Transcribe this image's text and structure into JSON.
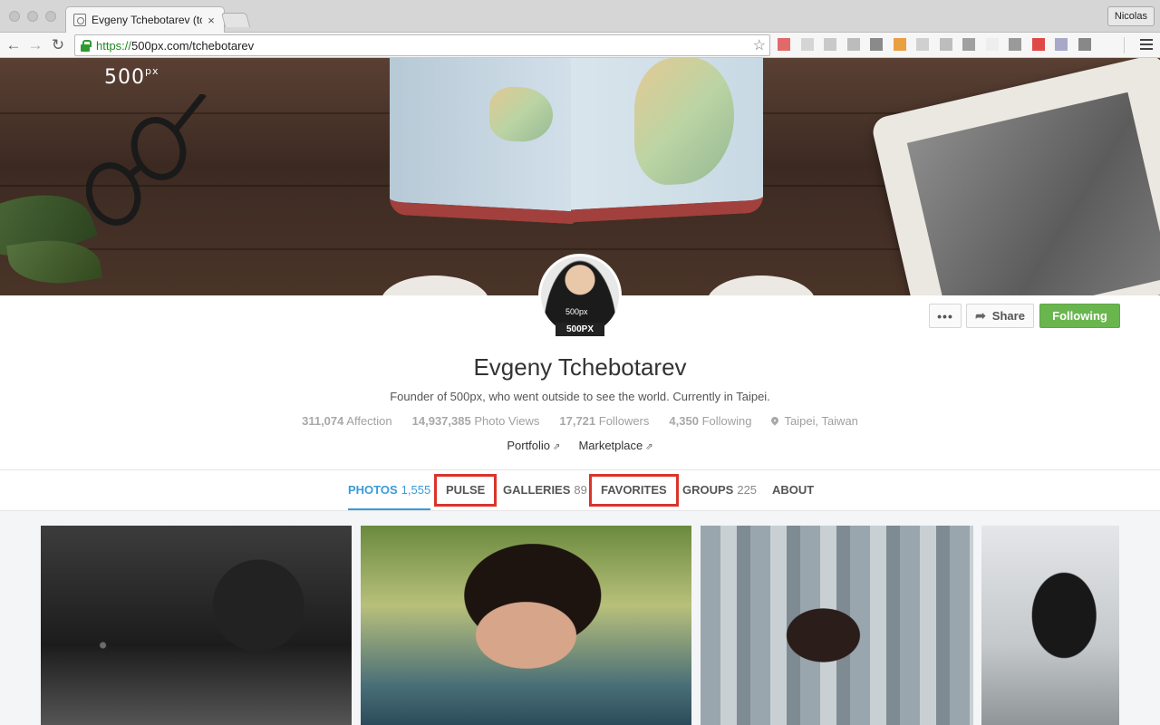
{
  "browser": {
    "tab_title": "Evgeny Tchebotarev (tcheb",
    "tab_close": "×",
    "user_name": "Nicolas",
    "url_scheme": "https://",
    "url_rest": "500px.com/tchebotarev",
    "back_icon": "←",
    "forward_icon": "→",
    "reload_icon": "↻",
    "star_icon": "☆",
    "extension_colors": [
      "#e06a6a",
      "#d5d5d5",
      "#c9c9c9",
      "#bcbcbc",
      "#8a8a8a",
      "#e8a040",
      "#d0d0d0",
      "#bdbdbd",
      "#a0a0a0",
      "#eeeeee",
      "#9a9a9a",
      "#e04848",
      "#a8a8c8",
      "#888888"
    ]
  },
  "cover": {
    "logo_text": "500",
    "logo_sup": "px"
  },
  "profile": {
    "avatar_shirt_text": "500px",
    "avatar_badge": "500PX",
    "more_button": "•••",
    "share_icon": "➦",
    "share_button": "Share",
    "follow_button": "Following",
    "follow_color": "#6ab64e",
    "name": "Evgeny Tchebotarev",
    "bio": "Founder of 500px, who went outside to see the world. Currently in Taipei.",
    "stats": [
      {
        "value": "311,074",
        "label": "Affection"
      },
      {
        "value": "14,937,385",
        "label": "Photo Views"
      },
      {
        "value": "17,721",
        "label": "Followers"
      },
      {
        "value": "4,350",
        "label": "Following"
      }
    ],
    "location": "Taipei, Taiwan",
    "links": [
      {
        "label": "Portfolio",
        "icon": "⇗"
      },
      {
        "label": "Marketplace",
        "icon": "⇗"
      }
    ]
  },
  "tabs": [
    {
      "label": "PHOTOS",
      "count": "1,555",
      "active": true
    },
    {
      "label": "PULSE",
      "count": "",
      "highlighted": true
    },
    {
      "label": "GALLERIES",
      "count": "89"
    },
    {
      "label": "FAVORITES",
      "count": "",
      "highlighted": true
    },
    {
      "label": "GROUPS",
      "count": "225"
    },
    {
      "label": "ABOUT",
      "count": ""
    }
  ],
  "accent_color": "#3a9bd9",
  "highlight_color": "#d9342b"
}
